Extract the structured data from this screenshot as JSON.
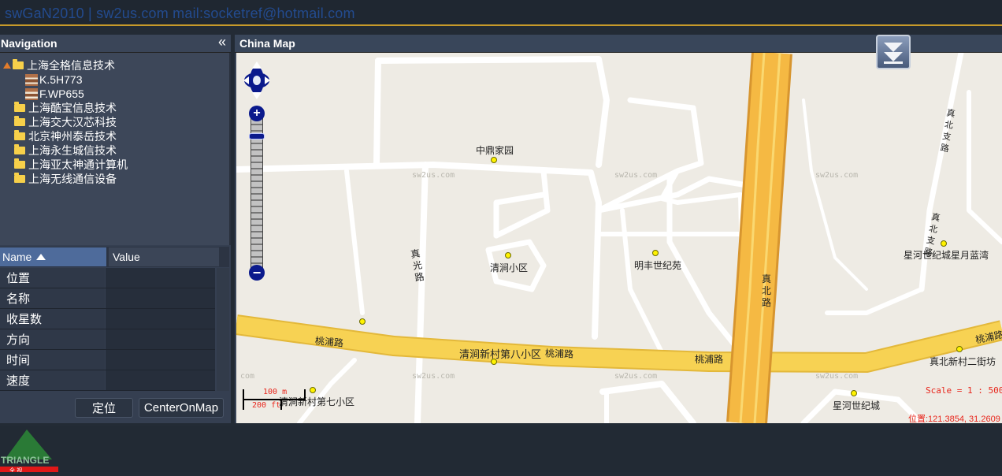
{
  "app": {
    "title": "swGaN2010 | sw2us.com mail:socketref@hotmail.com"
  },
  "navigation": {
    "title": "Navigation",
    "collapse_icon": "«",
    "groups": [
      {
        "label": "上海全格信息技术",
        "expanded": true,
        "vehicles": [
          "K.5H773",
          "F.WP655"
        ]
      },
      {
        "label": "上海酷宝信息技术"
      },
      {
        "label": "上海交大汉芯科技"
      },
      {
        "label": "北京神州泰岳技术"
      },
      {
        "label": "上海永生城信技术"
      },
      {
        "label": "上海亚太神通计算机"
      },
      {
        "label": "上海无线通信设备"
      }
    ]
  },
  "grid": {
    "columns": {
      "name": "Name",
      "value": "Value"
    },
    "rows": [
      {
        "name": "位置",
        "value": ""
      },
      {
        "name": "名称",
        "value": ""
      },
      {
        "name": "收星数",
        "value": ""
      },
      {
        "name": "方向",
        "value": ""
      },
      {
        "name": "时间",
        "value": ""
      },
      {
        "name": "速度",
        "value": ""
      }
    ]
  },
  "buttons": {
    "locate": "定位",
    "center": "CenterOnMap"
  },
  "map": {
    "title": "China Map",
    "watermark": "sw2us.com",
    "watermark_short": "com",
    "labels": {
      "zhongding": "中鼎家园",
      "qingjian": "清涧小区",
      "mingfeng": "明丰世纪苑",
      "xinghe_yue": "星河世纪城星月蓝湾",
      "qingjian8": "清涧新村第八小区",
      "qingjian7": "清涧新村第七小区",
      "taopu1": "桃浦路",
      "taopu2": "桃浦路",
      "taopu3": "桃浦路",
      "taopu4": "桃浦路",
      "zhenbei2": "真北新村二街坊",
      "xinghe": "星河世纪城",
      "zhenguang_road": "真光路",
      "zhenbei_road": "真北路",
      "zhenbei_branch1": "真北支路",
      "zhenbei_branch2": "真北支路"
    },
    "scale_bar": {
      "meters": "100 m",
      "feet": "200 ft"
    },
    "scale": "Scale = 1 : 5000",
    "position": "位置:121.3854, 31.2609",
    "zoom_level_fraction": 0.03
  },
  "logo": {
    "text": "TRIANGLE",
    "subtext": "全 视"
  },
  "colors": {
    "road_major": "#f7d253",
    "road_highway": "#f5b943",
    "accent": "#c79a2a",
    "header_blue": "#4e6b9b"
  }
}
